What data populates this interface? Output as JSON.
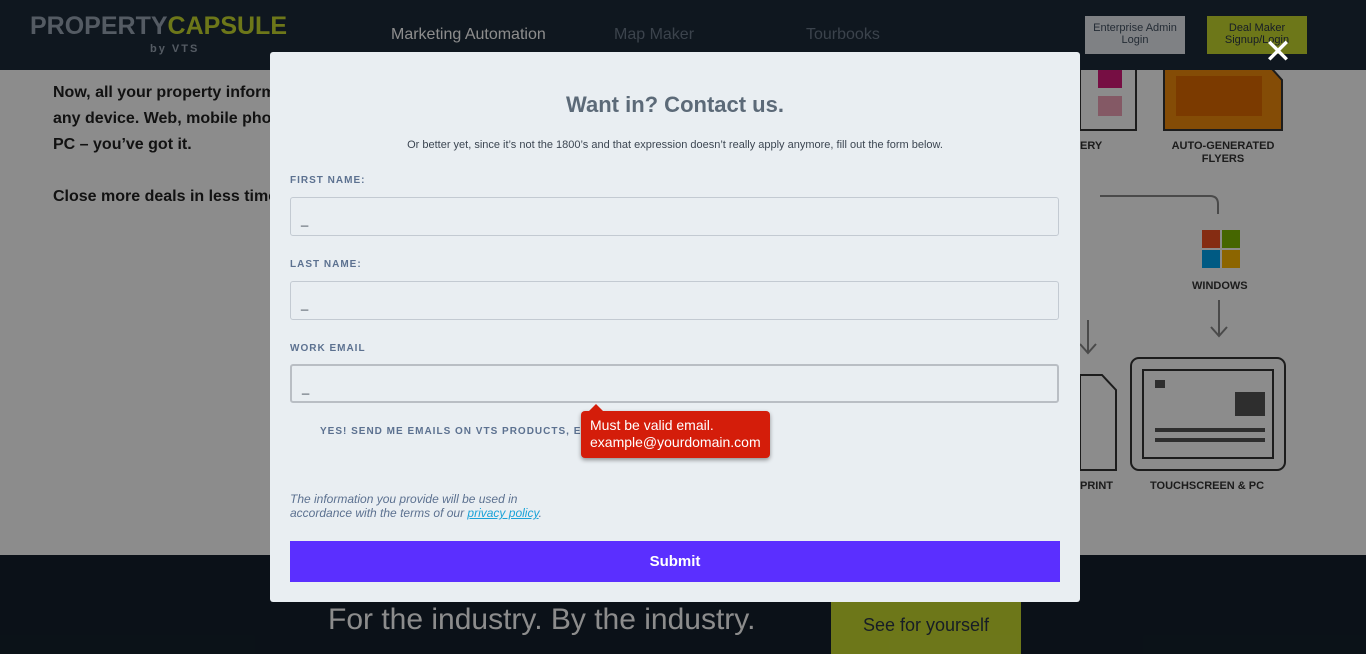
{
  "header": {
    "logo_main": "PROPERTY",
    "logo_accent": "CAPSULE",
    "logo_sub": "by VTS",
    "nav": [
      "Marketing Automation",
      "Map Maker",
      "Tourbooks"
    ],
    "admin_login": "Enterprise Admin Login",
    "signup_login": "Deal Maker Signup/Login"
  },
  "background": {
    "para1_line1": "Now, all your property informat",
    "para1_line2": "any device. Web, mobile phone",
    "para1_line3": "PC – you’ve got it.",
    "para2": "Close more deals in less time.",
    "feature_labels": [
      "ERY",
      "AUTO-GENERATED FLYERS",
      "WINDOWS",
      "PRINT",
      "TOUCHSCREEN & PC"
    ],
    "tagline": "For the industry. By the industry.",
    "cta": "See for yourself"
  },
  "modal": {
    "close_glyph": "✕",
    "title": "Want in? Contact us.",
    "subtitle": "Or better yet, since it’s not the 1800’s and that expression doesn’t really apply anymore, fill out the form below.",
    "first_name_label": "FIRST NAME:",
    "first_name_value": "_",
    "last_name_label": "LAST NAME:",
    "last_name_value": "_",
    "email_label": "WORK EMAIL",
    "email_value": "_",
    "optin_label": "YES! SEND ME EMAILS ON VTS PRODUCTS, EX",
    "privacy_text": "The information you provide will be used in accordance with the terms of our ",
    "privacy_link": "privacy policy",
    "privacy_end": ".",
    "submit_label": "Submit",
    "error_line1": "Must be valid email.",
    "error_line2": "example@yourdomain.com"
  },
  "colors": {
    "submit": "#5b2fff",
    "error": "#d41d0a",
    "link": "#1aa3d8"
  }
}
